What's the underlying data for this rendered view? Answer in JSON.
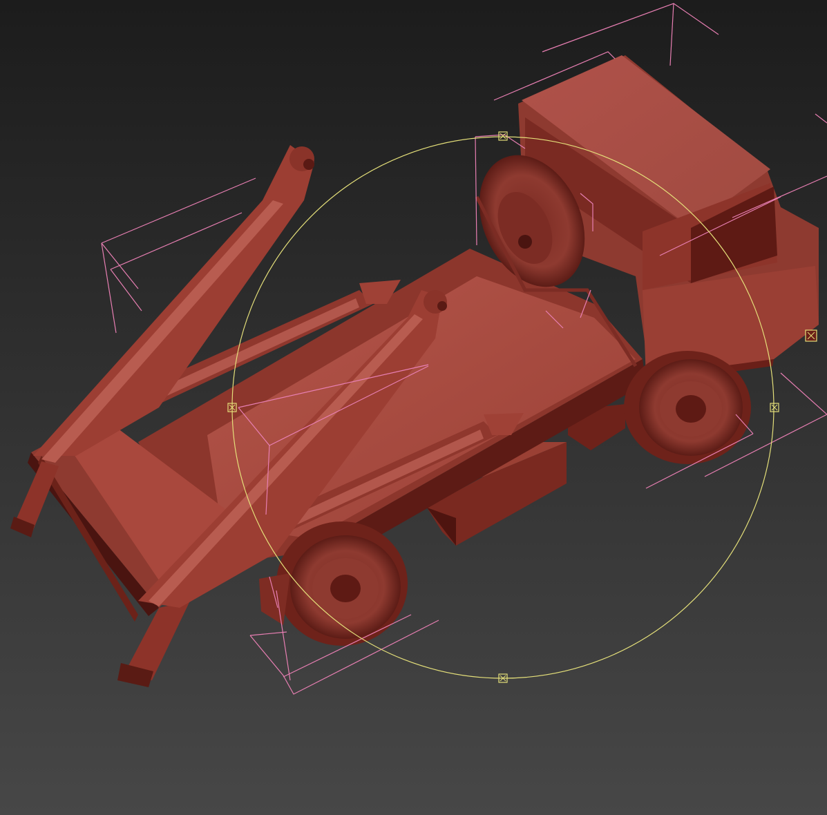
{
  "viewport": {
    "background_top": "#1c1c1c",
    "background_bottom": "#474747"
  },
  "model": {
    "kind": "skip-loader-truck",
    "material_color": "#a0473c",
    "shadow_color": "#5a1c16",
    "dark_color": "#3e0f0c"
  },
  "overlays": {
    "bounding_box_color": "#e87fb3",
    "light_gizmo_color": "#e5e07a",
    "gizmo_handles": [
      "gizmo-handle-top",
      "gizmo-handle-left",
      "gizmo-handle-right",
      "gizmo-handle-bottom",
      "gizmo-handle-corner"
    ]
  }
}
